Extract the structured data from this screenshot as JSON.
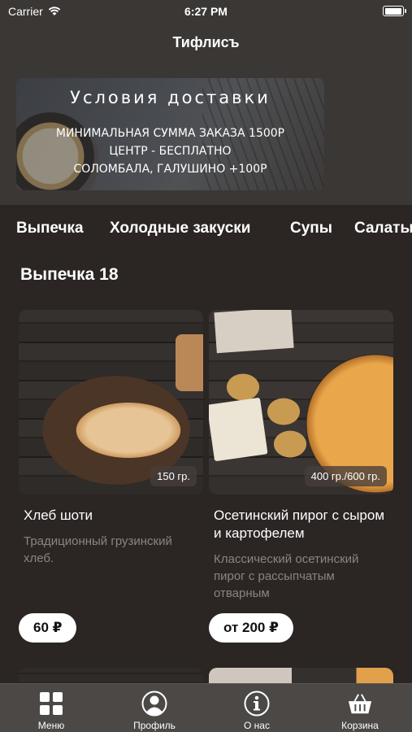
{
  "status_bar": {
    "carrier": "Carrier",
    "time": "6:27 PM",
    "battery_level": 1.0
  },
  "nav": {
    "title": "Тифлисъ"
  },
  "banner": {
    "title": "Условия доставки",
    "line1": "МИНИМАЛЬНАЯ СУММА ЗАКАЗА 1500Р",
    "line2": "ЦЕНТР - БЕСПЛАТНО",
    "line3": "СОЛОМБАЛА, ГАЛУШИНО +100Р"
  },
  "categories": [
    "Выпечка",
    "Холодные закуски",
    "Супы",
    "Салаты"
  ],
  "section": {
    "title": "Выпечка 18"
  },
  "products": [
    {
      "name": "Хлеб шоти",
      "description": "Традиционный грузинский хлеб.",
      "weight": "150 гр.",
      "price": "60 ₽"
    },
    {
      "name": "Осетинский пирог с сыром и картофелем",
      "description": "Классический осетинский пирог с рассыпчатым отварным",
      "weight": "400 гр./600 гр.",
      "price": "от 200 ₽"
    }
  ],
  "tabbar": {
    "menu": "Меню",
    "profile": "Профиль",
    "about": "О нас",
    "cart": "Корзина"
  }
}
